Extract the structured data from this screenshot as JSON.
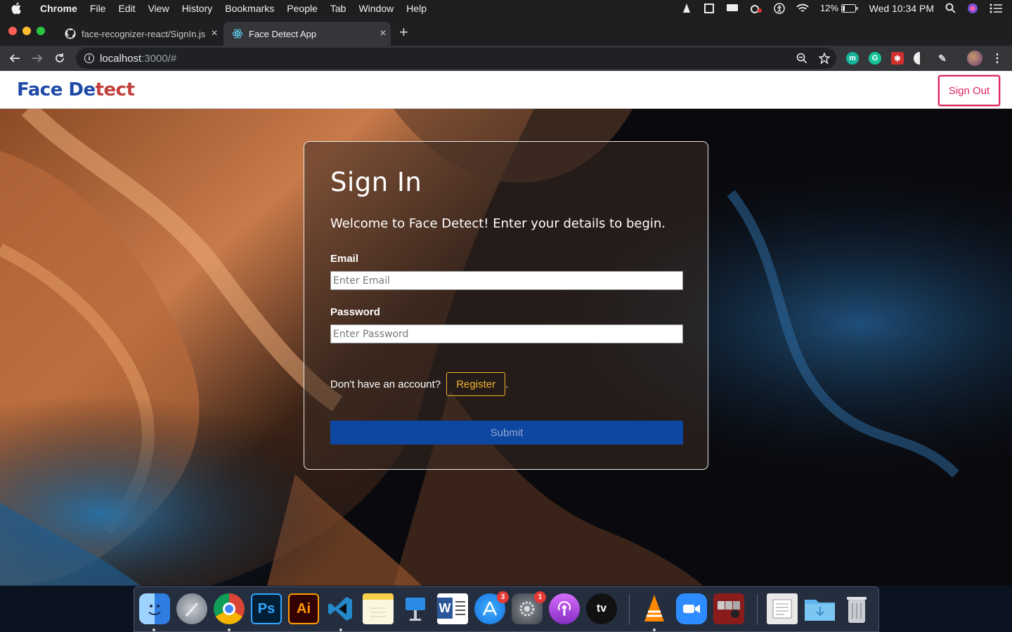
{
  "menubar": {
    "items": [
      "Chrome",
      "File",
      "Edit",
      "View",
      "History",
      "Bookmarks",
      "People",
      "Tab",
      "Window",
      "Help"
    ],
    "battery": "12%",
    "clock": "Wed 10:34 PM"
  },
  "browser": {
    "tabs": [
      {
        "title": "face-recognizer-react/SignIn.js",
        "icon": "github-icon"
      },
      {
        "title": "Face Detect App",
        "icon": "react-icon"
      }
    ],
    "url_host": "localhost",
    "url_path": ":3000/#"
  },
  "app": {
    "logo_part1": "Face De",
    "logo_part2": "tect",
    "sign_out": "Sign Out"
  },
  "signin": {
    "title": "Sign In",
    "subtitle": "Welcome to Face Detect! Enter your details to begin.",
    "email_label": "Email",
    "email_placeholder": "Enter Email",
    "password_label": "Password",
    "password_placeholder": "Enter Password",
    "no_account": "Don't have an account?",
    "register": "Register",
    "trailing": ".",
    "submit": "Submit"
  },
  "dock": {
    "badges": {
      "appstore": "3",
      "settings": "1"
    }
  },
  "colors": {
    "signout": "#e0245e",
    "register": "#f0b429",
    "submit_bg": "#0d47a1"
  }
}
